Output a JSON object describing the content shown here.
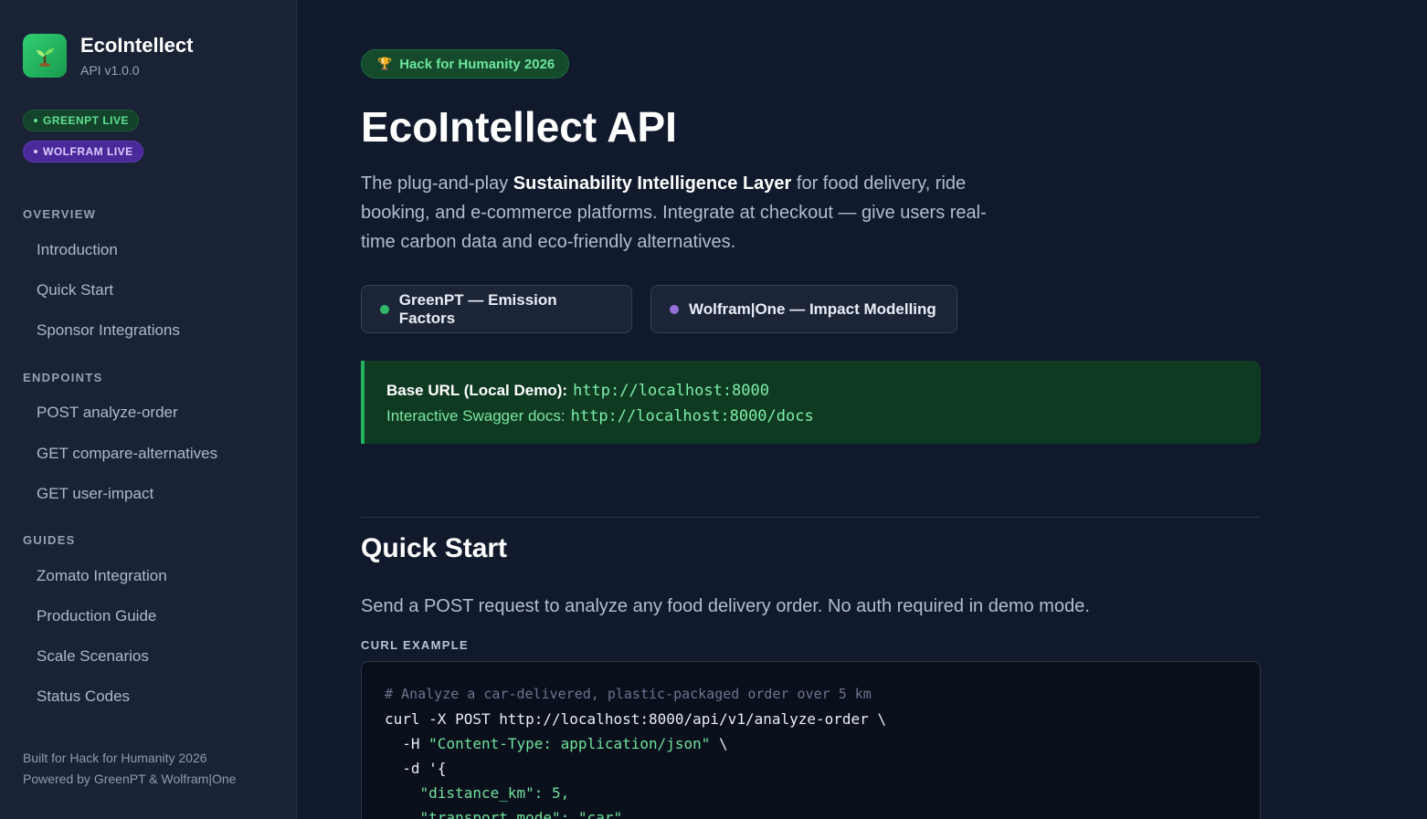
{
  "sidebar": {
    "brand_name": "EcoIntellect",
    "version": "API v1.0.0",
    "status": [
      {
        "label": "GREENPT LIVE"
      },
      {
        "label": "WOLFRAM LIVE"
      }
    ],
    "sections": [
      {
        "title": "OVERVIEW",
        "items": [
          "Introduction",
          "Quick Start",
          "Sponsor Integrations"
        ]
      },
      {
        "title": "ENDPOINTS",
        "items": [
          "POST analyze-order",
          "GET compare-alternatives",
          "GET user-impact"
        ]
      },
      {
        "title": "GUIDES",
        "items": [
          "Zomato Integration",
          "Production Guide",
          "Scale Scenarios",
          "Status Codes"
        ]
      }
    ],
    "footer": [
      "Built for Hack for Humanity 2026",
      "Powered by GreenPT & Wolfram|One"
    ]
  },
  "main": {
    "badge": "Hack for Humanity 2026",
    "title": "EcoIntellect API",
    "lead_before": "The plug-and-play ",
    "lead_strong": "Sustainability Intelligence Layer",
    "lead_after": " for food delivery, ride booking, and e-commerce platforms. Integrate at checkout — give users real-time carbon data and eco-friendly alternatives.",
    "sponsors": [
      {
        "label": "GreenPT — Emission Factors",
        "color": "#2fb868"
      },
      {
        "label": "Wolfram|One — Impact Modelling",
        "color": "#9470d8"
      }
    ],
    "base_url": {
      "label": "Base URL (Local Demo):",
      "url": "http://localhost:8000",
      "docs_label": "Interactive Swagger docs:",
      "docs_url": "http://localhost:8000/docs"
    },
    "quick_start": {
      "title": "Quick Start",
      "description": "Send a POST request to analyze any food delivery order. No auth required in demo mode.",
      "code_label": "CURL EXAMPLE",
      "code_lines": [
        "# Analyze a car-delivered, plastic-packaged order over 5 km",
        "curl -X POST http://localhost:8000/api/v1/analyze-order \\",
        "  -H ",
        "  -d '{",
        "    ",
        "    "
      ],
      "code_strings": [
        "\"Content-Type: application/json\"",
        "\"distance_km\": 5,",
        "\"transport_mode\": \"car\","
      ],
      "code_tail": " \\"
    }
  }
}
